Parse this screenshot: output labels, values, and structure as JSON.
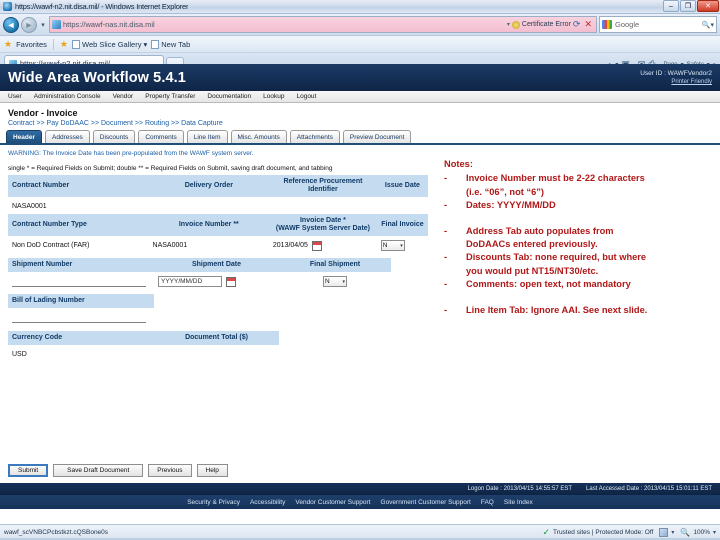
{
  "browser": {
    "window_title": "https://wawf-n2.nit.disa.mil/ - Windows Internet Explorer",
    "minimize_label": "–",
    "maximize_label": "❐",
    "close_label": "✕",
    "url": "https://wawf-nas.nit.disa.mil",
    "url_caret": "▾",
    "cert_error": "Certificate Error",
    "refresh_label": "⟳",
    "stop_label": "✕",
    "search_placeholder": "Google",
    "search_caret": "▾",
    "favorites_label": "Favorites",
    "web_slice_label": "Web Slice Gallery",
    "web_slice_caret": "▾",
    "new_tab_label": "New Tab",
    "tab_title": "https://wawf-n2.nit.disa.mil/",
    "toolbar": {
      "home": "⌂",
      "feeds": "▣",
      "mail": "✉",
      "print": "⎙",
      "page_label": "Page",
      "safety_label": "Safety",
      "overflow": "»",
      "caret": "▾",
      "dash": "·"
    }
  },
  "wawf": {
    "app_title": "Wide Area Workflow 5.4.1",
    "user_id_label": "User ID : WAWFVendor2",
    "printer_friendly": "Printer Friendly",
    "nav": [
      "User",
      "Administration Console",
      "Vendor",
      "Property Transfer",
      "Documentation",
      "Lookup",
      "Logout"
    ],
    "page_title": "Vendor - Invoice",
    "breadcrumb": "Contract >> Pay DoDAAC >> Document >> Routing >> Data Capture",
    "tabs": [
      "Header",
      "Addresses",
      "Discounts",
      "Comments",
      "Line Item",
      "Misc. Amounts",
      "Attachments",
      "Preview Document"
    ],
    "active_tab": "Header",
    "warning": "WARNING: The Invoice Date has been pre-populated from the WAWF system server.",
    "required_note": "single * = Required Fields on Submit; double ** = Required Fields on Submit, saving draft document, and tabbing",
    "form": {
      "row1_headers": [
        "Contract Number",
        "Delivery Order",
        "Reference Procurement Identifier",
        "Issue Date"
      ],
      "row1_values": [
        "NASA0001",
        "",
        "",
        ""
      ],
      "row2_headers": [
        "Contract Number Type",
        "Invoice Number **",
        "Invoice Date *\n(WAWF System Server Date)",
        "Final Invoice"
      ],
      "row2_header_3_line1": "Invoice Date *",
      "row2_header_3_line2": "(WAWF System Server Date)",
      "contract_number_type": "Non DoD Contract (FAR)",
      "invoice_number_value": "NASA0001",
      "invoice_date_value": "2013/04/05",
      "final_invoice_value": "N",
      "row3_headers": [
        "Shipment Number",
        "Shipment Date",
        "Final Shipment"
      ],
      "shipment_number_value": "",
      "shipment_date_placeholder": "YYYY/MM/DD",
      "final_shipment_value": "N",
      "bill_of_lading_header": "Bill of Lading Number",
      "bill_of_lading_value": "",
      "row5_headers": [
        "Currency Code",
        "Document Total ($)"
      ],
      "currency_code_value": "USD",
      "document_total_value": "",
      "dropdown_arrow": "▾"
    },
    "buttons": [
      "Submit",
      "Save Draft Document",
      "Previous",
      "Help"
    ],
    "footer": {
      "logon_date": "Logon Date : 2013/04/15 14:55:57 EST",
      "last_accessed_date": "Last Accessed Date : 2013/04/15 15:01:11 EST",
      "links": [
        "Security & Privacy",
        "Accessibility",
        "Vendor Customer Support",
        "Government Customer Support",
        "FAQ",
        "Site Index"
      ]
    }
  },
  "notes": {
    "title": "Notes:",
    "dash": "-",
    "items_group1": [
      "Invoice Number must be 2-22 characters (i.e. “06”, not “6”)",
      "Dates: YYYY/MM/DD"
    ],
    "item1_line1": "Invoice Number must be 2-22 characters",
    "item1_line2": "(i.e. “06”, not “6”)",
    "item2": "Dates: YYYY/MM/DD",
    "item3_line1": "Address Tab auto populates from",
    "item3_line2": "DoDAACs entered previously.",
    "item4_line1": "Discounts Tab: none required, but where",
    "item4_line2": "you would put NT15/NT30/etc.",
    "item5": "Comments: open text, not mandatory",
    "item6": "Line Item Tab: Ignore AAI.  See next slide."
  },
  "statusbar": {
    "left_text": "wawf_scVNBCPcbstkzt.cQSBone0s",
    "trusted": "Trusted sites | Protected Mode: Off",
    "zoom": "100%",
    "check": "✓",
    "caret": "▾"
  }
}
